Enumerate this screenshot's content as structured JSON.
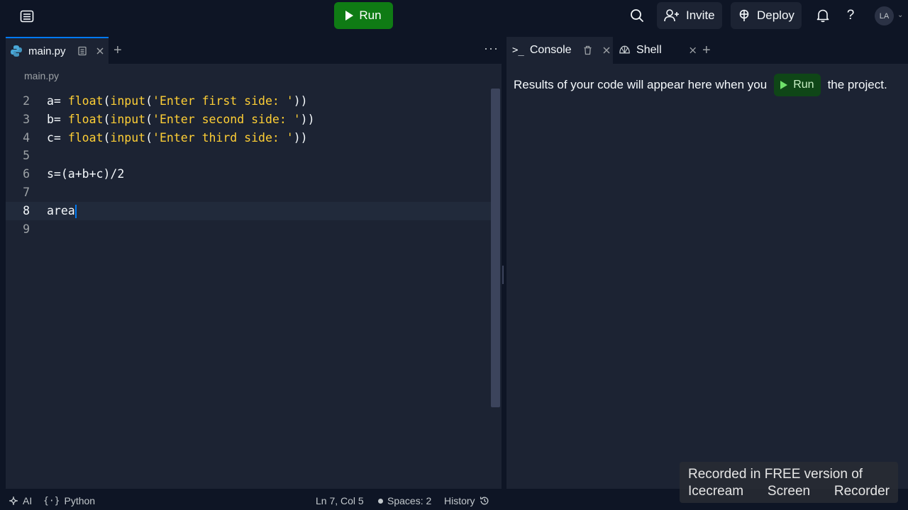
{
  "colors": {
    "background": "#0e1525",
    "surface": "#1c2333",
    "run_green": "#0f7b14",
    "accent_blue": "#0079f2",
    "syntax_yellow": "#ffcf35"
  },
  "topbar": {
    "menu_icon": "layout-icon",
    "run_label": "Run",
    "search_icon": "search-icon",
    "invite_label": "Invite",
    "deploy_label": "Deploy",
    "bell_icon": "bell-icon",
    "help_glyph": "?",
    "avatar_initials": "LA"
  },
  "editor": {
    "tab_label": "main.py",
    "breadcrumb": "main.py",
    "lines": [
      {
        "n": "2",
        "parts": [
          {
            "t": "a= ",
            "c": "plain"
          },
          {
            "t": "float",
            "c": "fn"
          },
          {
            "t": "(",
            "c": "plain"
          },
          {
            "t": "input",
            "c": "fn"
          },
          {
            "t": "(",
            "c": "plain"
          },
          {
            "t": "'Enter first side: '",
            "c": "str"
          },
          {
            "t": "))",
            "c": "plain"
          }
        ]
      },
      {
        "n": "3",
        "parts": [
          {
            "t": "b= ",
            "c": "plain"
          },
          {
            "t": "float",
            "c": "fn"
          },
          {
            "t": "(",
            "c": "plain"
          },
          {
            "t": "input",
            "c": "fn"
          },
          {
            "t": "(",
            "c": "plain"
          },
          {
            "t": "'Enter second side: '",
            "c": "str"
          },
          {
            "t": "))",
            "c": "plain"
          }
        ]
      },
      {
        "n": "4",
        "parts": [
          {
            "t": "c= ",
            "c": "plain"
          },
          {
            "t": "float",
            "c": "fn"
          },
          {
            "t": "(",
            "c": "plain"
          },
          {
            "t": "input",
            "c": "fn"
          },
          {
            "t": "(",
            "c": "plain"
          },
          {
            "t": "'Enter third side: '",
            "c": "str"
          },
          {
            "t": "))",
            "c": "plain"
          }
        ]
      },
      {
        "n": "5",
        "parts": []
      },
      {
        "n": "6",
        "parts": [
          {
            "t": "s=(a+b+c)/2",
            "c": "plain"
          }
        ]
      },
      {
        "n": "7",
        "parts": []
      },
      {
        "n": "8",
        "parts": [
          {
            "t": "area",
            "c": "plain"
          }
        ],
        "current": true
      },
      {
        "n": "9",
        "parts": []
      }
    ]
  },
  "console": {
    "console_tab": "Console",
    "shell_tab": "Shell",
    "results_before": "Results of your code will appear here when you",
    "results_run": "Run",
    "results_after": "the project."
  },
  "statusbar": {
    "ai_label": "AI",
    "language": "Python",
    "cursor_pos": "Ln 7, Col 5",
    "spaces": "Spaces: 2",
    "history": "History"
  },
  "watermark": {
    "line1": "Recorded in FREE version of",
    "line2_words": [
      "Icecream",
      "Screen",
      "Recorder"
    ]
  }
}
